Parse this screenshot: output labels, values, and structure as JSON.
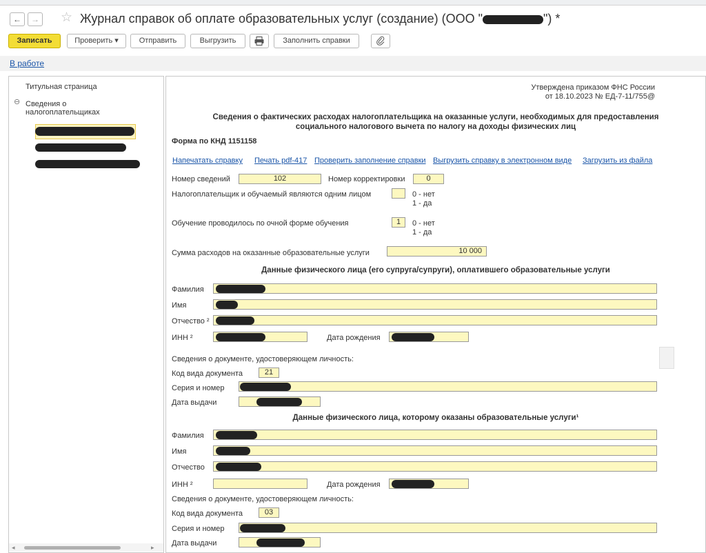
{
  "header": {
    "title": "Журнал справок об оплате образовательных услуг (создание) (ООО \"",
    "title_tail": "\") *",
    "back_glyph": "←",
    "forward_glyph": "→",
    "star_glyph": "☆"
  },
  "toolbar": {
    "save": "Записать",
    "check": "Проверить",
    "check_arrow": "▾",
    "send": "Отправить",
    "export": "Выгрузить",
    "fill": "Заполнить справки"
  },
  "status": {
    "label": "В работе"
  },
  "tree": {
    "title_page": "Титульная страница",
    "group_label_1": "Сведения о",
    "group_label_2": "налогоплательщиках",
    "collapse_glyph": "⊖"
  },
  "form": {
    "approved_1": "Утверждена приказом ФНС России",
    "approved_2": "от 18.10.2023 № ЕД-7-11/755@",
    "heading_1": "Сведения о фактических расходах налогоплательщика на оказанные услуги, необходимых для предоставления",
    "heading_2": "социального налогового вычета по налогу на доходы физических лиц",
    "knd": "Форма по КНД 1151158",
    "links": [
      "Напечатать справку",
      "Печать pdf-417",
      "Проверить заполнение справки",
      "Выгрузить справку в электронном виде",
      "Загрузить из файла"
    ],
    "number_label": "Номер сведений",
    "number_value": "102",
    "correction_label": "Номер корректировки",
    "correction_value": "0",
    "same_person_label": "Налогоплательщик и обучаемый являются одним лицом",
    "same_person_value": "",
    "opt_no": "0 - нет",
    "opt_yes": "1 - да",
    "fulltime_label": "Обучение проводилось по очной форме обучения",
    "fulltime_value": "1",
    "sum_label": "Сумма расходов на оказанные образовательные услуги",
    "sum_value": "10 000",
    "payer_title": "Данные физического лица (его супруга/супруги), оплатившего образовательные услуги",
    "student_title": "Данные физического лица, которому оказаны образовательные услуги¹",
    "last_name": "Фамилия",
    "first_name": "Имя",
    "patronymic_sup": "Отчество ²",
    "patronymic": "Отчество",
    "inn": "ИНН ²",
    "birth_date": "Дата рождения",
    "doc_info": "Сведения о документе, удостоверяющем личность:",
    "doc_code": "Код вида документа",
    "payer_doc_code": "21",
    "student_doc_code": "03",
    "series": "Серия и номер",
    "issue_date": "Дата выдачи"
  },
  "scroll": {
    "left_arrow": "◂",
    "right_arrow": "▸"
  }
}
